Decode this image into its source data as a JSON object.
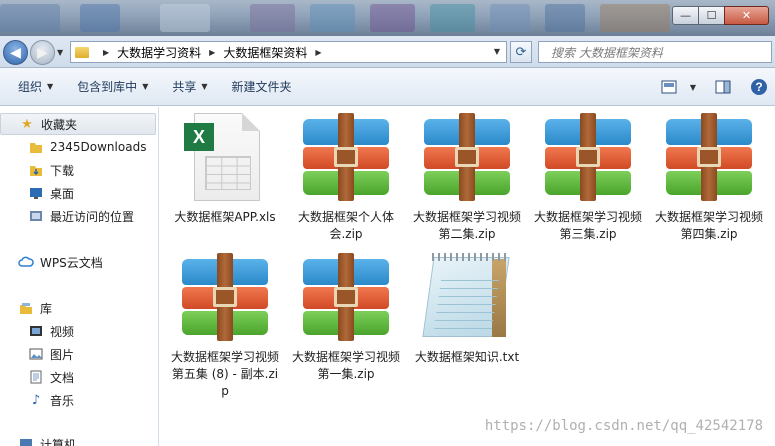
{
  "window": {
    "minimize_glyph": "—",
    "maximize_glyph": "☐",
    "close_glyph": "✕"
  },
  "address": {
    "crumbs": [
      "大数据学习资料",
      "大数据框架资料"
    ],
    "search_placeholder": "搜索 大数据框架资料"
  },
  "toolbar": {
    "organize": "组织",
    "include_in_library": "包含到库中",
    "share": "共享",
    "new_folder": "新建文件夹"
  },
  "sidebar": {
    "favorites": "收藏夹",
    "items": [
      "2345Downloads",
      "下载",
      "桌面",
      "最近访问的位置"
    ],
    "wps": "WPS云文档",
    "library": "库",
    "library_items": [
      "视频",
      "图片",
      "文档",
      "音乐"
    ],
    "computer": "计算机"
  },
  "files": [
    {
      "name": "大数据框架APP.xls",
      "type": "xls"
    },
    {
      "name": "大数据框架个人体会.zip",
      "type": "zip"
    },
    {
      "name": "大数据框架学习视频第二集.zip",
      "type": "zip"
    },
    {
      "name": "大数据框架学习视频第三集.zip",
      "type": "zip"
    },
    {
      "name": "大数据框架学习视频第四集.zip",
      "type": "zip"
    },
    {
      "name": "大数据框架学习视频第五集 (8) - 副本.zip",
      "type": "zip"
    },
    {
      "name": "大数据框架学习视频第一集.zip",
      "type": "zip"
    },
    {
      "name": "大数据框架知识.txt",
      "type": "txt"
    }
  ],
  "watermark": "https://blog.csdn.net/qq_42542178",
  "colors": {
    "accent": "#2f63a8",
    "excel": "#1f7a43"
  }
}
